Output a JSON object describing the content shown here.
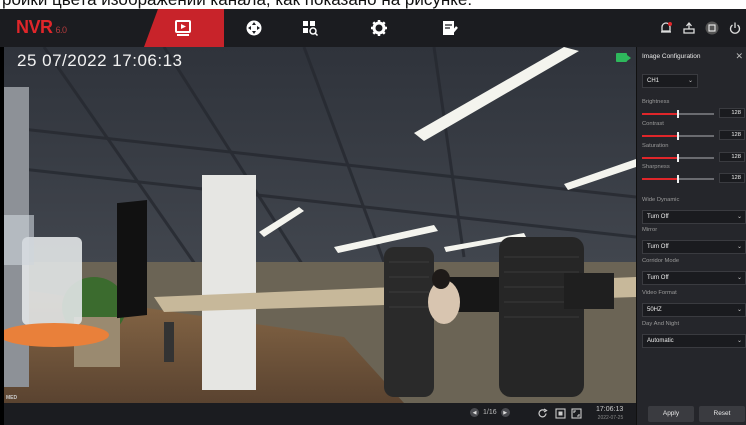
{
  "caption": "ройки цвета изображении канала, как показано на рисунке:",
  "app": {
    "logo": "NVR",
    "version": "6.0"
  },
  "nav": [
    "playback-icon",
    "camera-control-icon",
    "search-icon",
    "settings-icon",
    "maintenance-icon"
  ],
  "top_right": [
    "alarm-icon",
    "backup-icon",
    "display-icon",
    "power-icon"
  ],
  "video": {
    "osd_datetime": "25 07/2022  17:06:13",
    "corner_text": "MED"
  },
  "bottombar": {
    "page": "1/16",
    "time": "17:06:13",
    "date": "2022-07-25"
  },
  "panel": {
    "title": "Image Configuration",
    "channel": "CH1",
    "sliders": [
      {
        "label": "Brightness",
        "value": "128",
        "level": 0.5
      },
      {
        "label": "Contrast",
        "value": "128",
        "level": 0.5
      },
      {
        "label": "Saturation",
        "value": "128",
        "level": 0.5
      },
      {
        "label": "Sharpness",
        "value": "128",
        "level": 0.5
      }
    ],
    "dropdowns": [
      {
        "label": "Wide Dynamic",
        "value": "Turn Off"
      },
      {
        "label": "Mirror",
        "value": "Turn Off"
      },
      {
        "label": "Corridor Mode",
        "value": "Turn Off"
      },
      {
        "label": "Video Format",
        "value": "50HZ"
      },
      {
        "label": "Day And Night",
        "value": "Automatic"
      }
    ],
    "apply_label": "Apply",
    "reset_label": "Reset"
  },
  "colors": {
    "accent": "#c8232a",
    "panel_bg": "#25262b",
    "topbar_bg": "#1b1c20"
  }
}
